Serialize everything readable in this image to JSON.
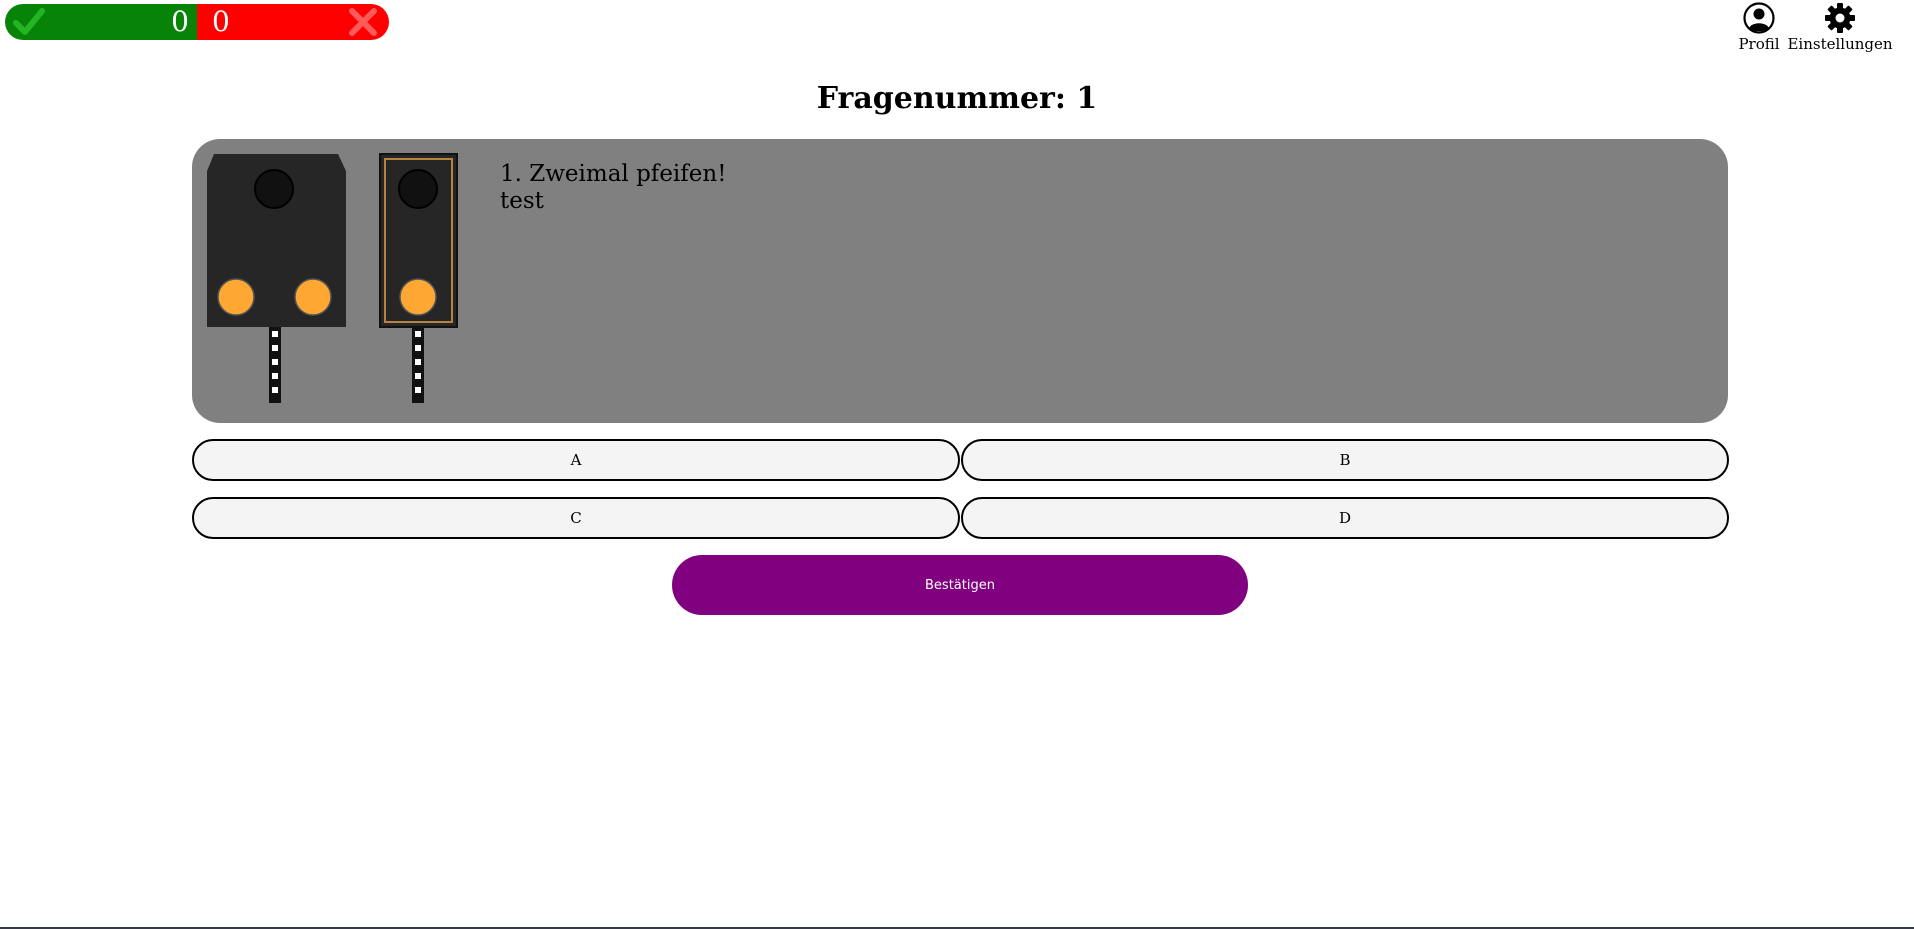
{
  "score": {
    "correct": "0",
    "wrong": "0"
  },
  "nav": {
    "profile_label": "Profil",
    "settings_label": "Einstellungen"
  },
  "question": {
    "heading": "Fragenummer: 1",
    "line1": "1. Zweimal pfeifen!",
    "line2": "test"
  },
  "answers": {
    "a": "A",
    "b": "B",
    "c": "C",
    "d": "D"
  },
  "confirm_label": "Bestätigen",
  "colors": {
    "correct_bg": "#078307",
    "wrong_bg": "#ff0000",
    "panel_bg": "#808080",
    "confirm_bg": "#800080",
    "signal_lamp_lit": "#ffa733",
    "signal_lamp_off": "#111111"
  },
  "icons": {
    "correct": "check-icon",
    "wrong": "cross-icon",
    "profile": "user-icon",
    "settings": "gear-icon"
  }
}
